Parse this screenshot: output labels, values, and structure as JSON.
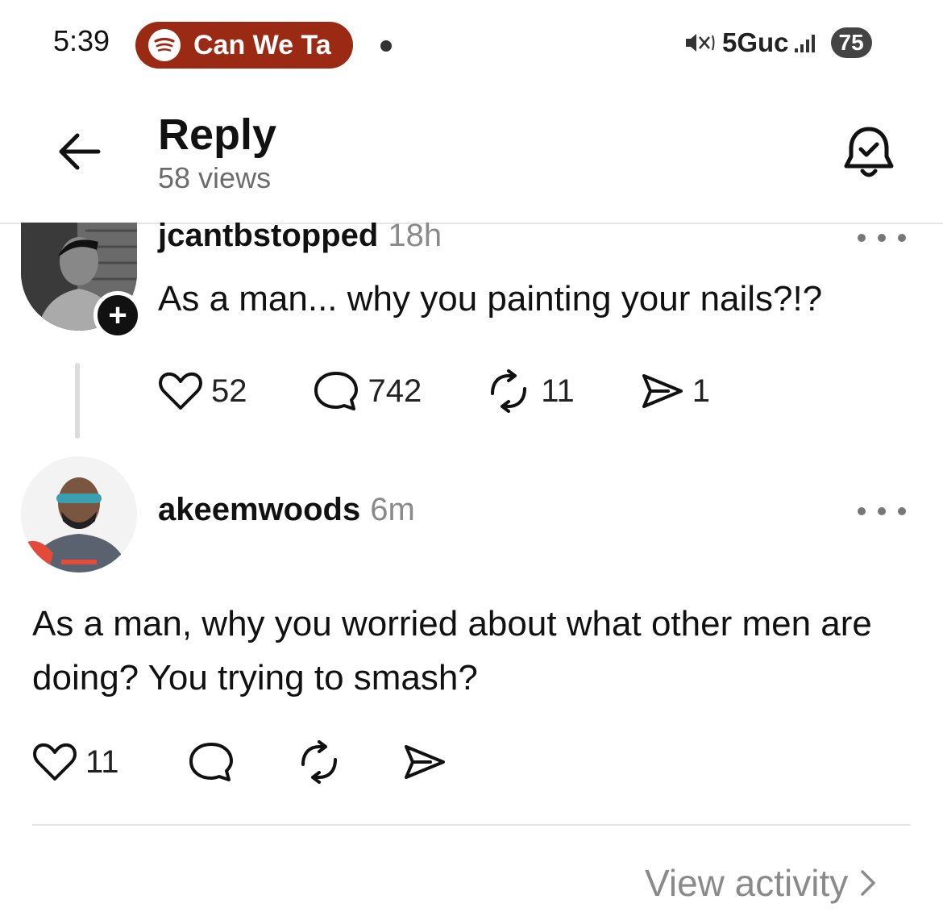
{
  "status_bar": {
    "time": "5:39",
    "media_pill": {
      "app_icon": "spotify-icon",
      "title": "Can We Ta",
      "color": "#9b2a14"
    },
    "network": "5Guc",
    "battery": "75"
  },
  "header": {
    "title": "Reply",
    "views": "58 views",
    "back_icon": "arrow-left-icon",
    "notify_icon": "bell-check-icon"
  },
  "posts": [
    {
      "username": "jcantbstopped",
      "time": "18h",
      "text": "As a man... why you painting your nails?!?",
      "likes": "52",
      "replies": "742",
      "reposts": "11",
      "shares": "1"
    },
    {
      "username": "akeemwoods",
      "time": "6m",
      "text": "As a man, why you worried about what other men are doing? You trying to smash?",
      "likes": "11"
    }
  ],
  "footer": {
    "view_activity": "View activity"
  }
}
